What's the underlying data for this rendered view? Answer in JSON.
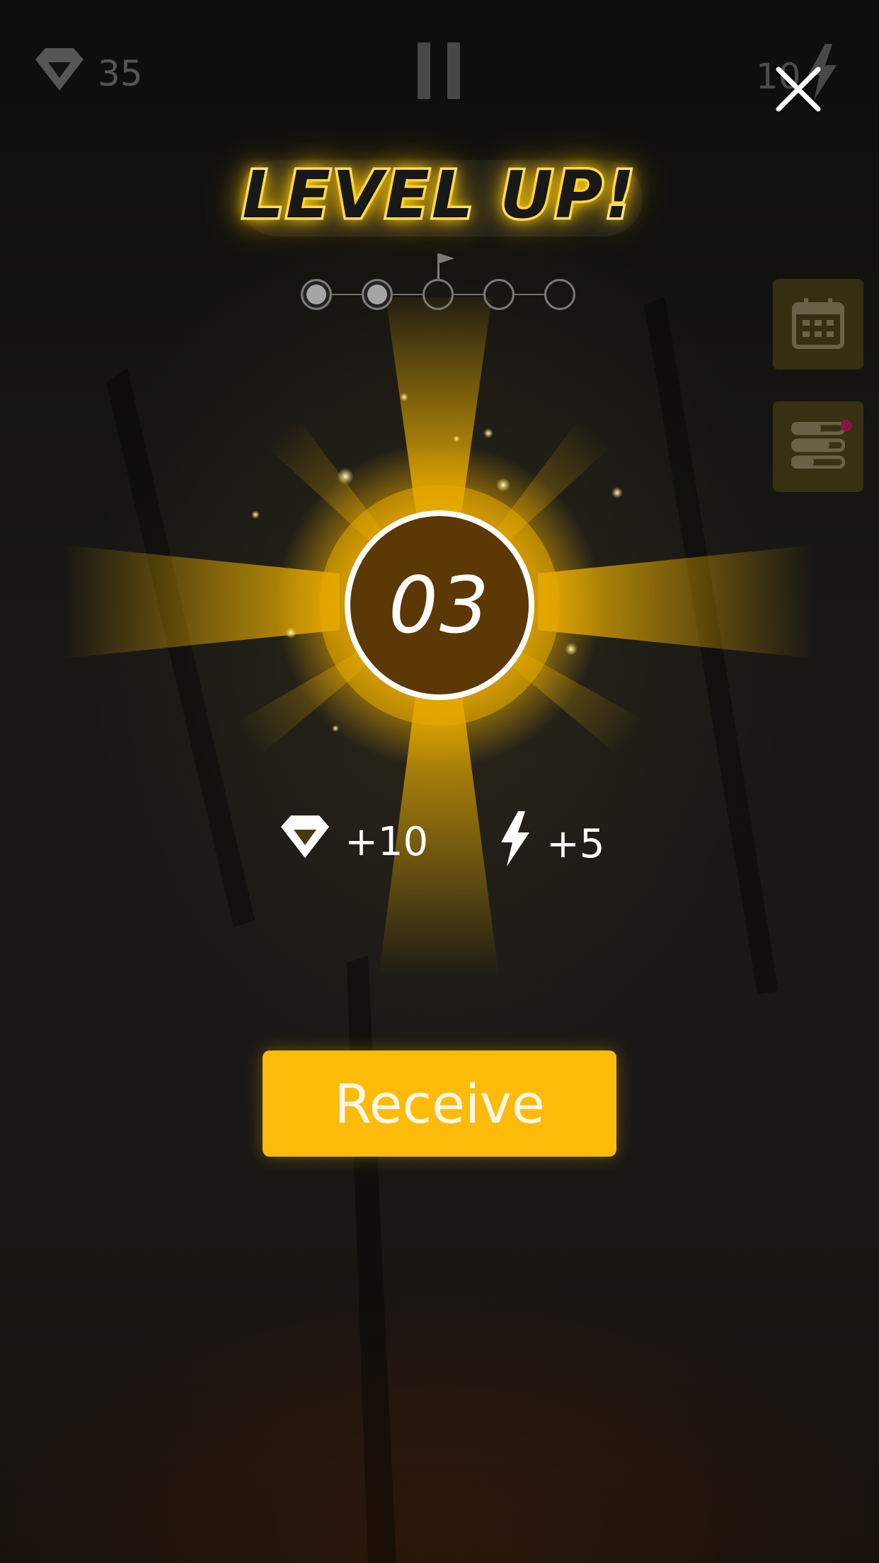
{
  "hud": {
    "gems_count": "35",
    "energy_count": "10",
    "pause_icon": "pause-icon",
    "calendar_icon": "calendar-icon",
    "menu_icon": "list-menu-icon"
  },
  "dialog": {
    "title": "LEVEL UP!",
    "close_icon": "close-icon",
    "progress": {
      "total_steps": 5,
      "completed_steps": 2,
      "flag_at_step": 3
    },
    "level": "03",
    "rewards": [
      {
        "icon": "gem-icon",
        "label": "+10"
      },
      {
        "icon": "lightning-icon",
        "label": "+5"
      }
    ],
    "receive_label": "Receive"
  },
  "colors": {
    "accent": "#ffbb09",
    "glow": "#ffd21a",
    "level_fill": "#5c3805",
    "notification_dot": "#8a1540"
  }
}
